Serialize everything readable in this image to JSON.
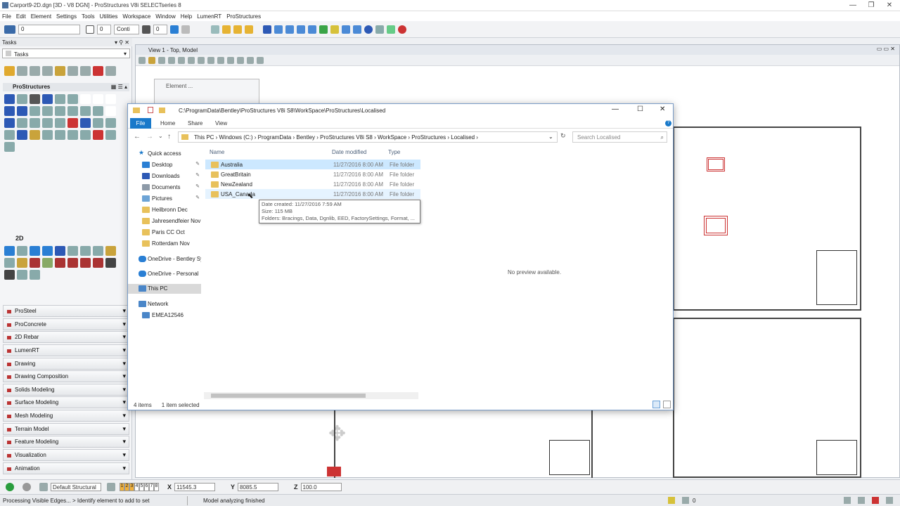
{
  "app": {
    "title": "Carport9-2D.dgn [3D - V8 DGN] - ProStructures V8i SELECTseries 8"
  },
  "menu": [
    "File",
    "Edit",
    "Element",
    "Settings",
    "Tools",
    "Utilities",
    "Workspace",
    "Window",
    "Help",
    "LumenRT",
    "ProStructures"
  ],
  "toolbar": {
    "level_value": "0",
    "weight_value": "0",
    "style_value": "Conti",
    "num1": "0",
    "num2": "0"
  },
  "tasks": {
    "header": "Tasks",
    "selector": "Tasks",
    "section": "ProStructures",
    "label_2d": "2D",
    "groups": [
      "ProSteel",
      "ProConcrete",
      "2D Rebar",
      "LumenRT",
      "Drawing",
      "Drawing Composition",
      "Solids Modeling",
      "Surface Modeling",
      "Mesh Modeling",
      "Terrain Model",
      "Feature Modeling",
      "Visualization",
      "Animation"
    ]
  },
  "view": {
    "title": "View 1 - Top, Model"
  },
  "element_dialog": {
    "title": "Element ..."
  },
  "explorer": {
    "title_path": "C:\\ProgramData\\Bentley\\ProStructures V8i S8\\WorkSpace\\ProStructures\\Localised",
    "tabs": {
      "file": "File",
      "home": "Home",
      "share": "Share",
      "view": "View"
    },
    "breadcrumb": "This PC  ›  Windows (C:)  ›  ProgramData  ›  Bentley  ›  ProStructures V8i S8  ›  WorkSpace  ›  ProStructures  ›  Localised  ›",
    "search_placeholder": "Search Localised",
    "nav": {
      "quick_access": "Quick access",
      "desktop": "Desktop",
      "downloads": "Downloads",
      "documents": "Documents",
      "pictures": "Pictures",
      "heilbronn": "Heilbronn Dec",
      "jahresend": "Jahresendfeier Nov",
      "paris": "Paris CC Oct",
      "rotterdam": "Rotterdam Nov",
      "onedrive_b": "OneDrive - Bentley Sy",
      "onedrive_p": "OneDrive - Personal",
      "thispc": "This PC",
      "network": "Network",
      "emea": "EMEA12546"
    },
    "columns": {
      "name": "Name",
      "date": "Date modified",
      "type": "Type"
    },
    "rows": [
      {
        "name": "Australia",
        "date": "11/27/2016 8:00 AM",
        "type": "File folder"
      },
      {
        "name": "GreatBritain",
        "date": "11/27/2016 8:00 AM",
        "type": "File folder"
      },
      {
        "name": "NewZealand",
        "date": "11/27/2016 8:00 AM",
        "type": "File folder"
      },
      {
        "name": "USA_Canada",
        "date": "11/27/2016 8:00 AM",
        "type": "File folder"
      }
    ],
    "tooltip": {
      "line1": "Date created: 11/27/2016 7:59 AM",
      "line2": "Size: 115 MB",
      "line3": "Folders: Bracings, Data, Dgnlib, EED, FactorySettings, Format, ..."
    },
    "preview": "No preview available.",
    "status_items": "4 items",
    "status_selected": "1 item selected"
  },
  "coords": {
    "view_label": "Default Structural",
    "views": [
      "1",
      "2",
      "3",
      "4",
      "5",
      "6",
      "7",
      "8"
    ],
    "x_label": "X",
    "x_value": "11545.3",
    "y_label": "Y",
    "y_value": "8085.5",
    "z_label": "Z",
    "z_value": "100.0"
  },
  "statusbar": {
    "left": "Processing Visible Edges... > Identify element to add to set",
    "mid": "Model analyzing finished",
    "right_value": "0"
  }
}
